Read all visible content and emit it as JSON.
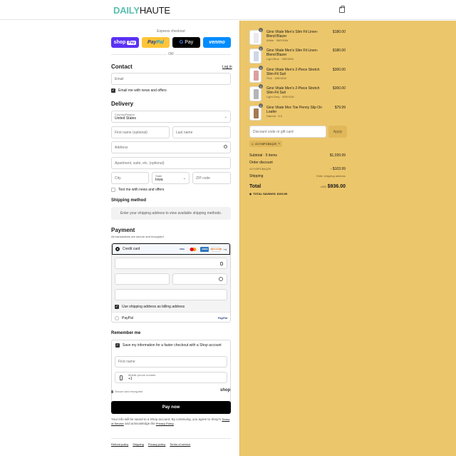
{
  "brand": {
    "part1": "DAILY",
    "part2": "HAUTE"
  },
  "express": {
    "label": "Express checkout",
    "shop": "shop",
    "shop_pay": "Pay",
    "paypal_a": "Pay",
    "paypal_b": "Pal",
    "gpay": "Pay",
    "gpay_g": "G",
    "venmo": "venmo",
    "or": "OR"
  },
  "contact": {
    "title": "Contact",
    "login": "Log in",
    "email_placeholder": "Email",
    "news_label": "Email me with news and offers"
  },
  "delivery": {
    "title": "Delivery",
    "country_label": "Country/Region",
    "country_value": "United States",
    "first_name": "First name (optional)",
    "last_name": "Last name",
    "address": "Address",
    "apartment": "Apartment, suite, etc. (optional)",
    "city": "City",
    "state_label": "State",
    "state_value": "Iowa",
    "zip": "ZIP code",
    "text_news": "Text me with news and offers"
  },
  "shipping_method": {
    "title": "Shipping method",
    "message": "Enter your shipping address to view available shipping methods."
  },
  "payment": {
    "title": "Payment",
    "subtitle": "All transactions are secure and encrypted.",
    "credit_card": "Credit card",
    "cards": [
      "VISA",
      "MC",
      "AMEX",
      "DISCOVER"
    ],
    "more": "+4",
    "billing_same": "Use shipping address as billing address",
    "paypal": "PayPal",
    "paypal_logo": "PayPal"
  },
  "remember": {
    "title": "Remember me",
    "save_label": "Save my information for a faster checkout with a Shop account",
    "first_name": "First name",
    "phone_label": "Mobile phone number",
    "phone_value": "+1",
    "secure": "Secure and encrypted",
    "shop": "shop"
  },
  "pay_now": "Pay now",
  "legal": {
    "text": "Your info will be saved to a Shop account. By continuing, you agree to Shop’s",
    "tos": "Terms of Service",
    "and": "and acknowledge the",
    "privacy": "Privacy Policy"
  },
  "footer": [
    "Refund policy",
    "Shipping",
    "Privacy policy",
    "Terms of service"
  ],
  "cart": {
    "items": [
      {
        "qty": "1",
        "title": "Gino Vitale Men's Slim Fit Linen-Blend Blazer",
        "variant": "White · 36R/30W",
        "price": "$180.00",
        "color": "#e9e9ee"
      },
      {
        "qty": "1",
        "title": "Gino Vitale Men's Slim Fit Linen-Blend Blazer",
        "variant": "Light Blue · 36R/30W",
        "price": "$180.00",
        "color": "#cdd7e6"
      },
      {
        "qty": "1",
        "title": "Gino Vitale Men's 2-Piece Stretch Slim-Fit Suit",
        "variant": "Pink · 48R/42W",
        "price": "$300.00",
        "color": "#d9a0a0"
      },
      {
        "qty": "1",
        "title": "Gino Vitale Men's 2-Piece Stretch Slim-Fit Suit",
        "variant": "Light Grey · 40R/42W",
        "price": "$300.00",
        "color": "#b5b5b8"
      },
      {
        "qty": "1",
        "title": "Gino Vitale Moc Toe Penny Slip On Loafer",
        "variant": "Natural · 6.5",
        "price": "$79.99",
        "color": "#a57a55"
      }
    ],
    "discount_placeholder": "Discount code or gift card",
    "apply": "Apply",
    "code": "41YX5PCB4Q29",
    "subtotal_label": "Subtotal · 5 items",
    "subtotal": "$1,039.99",
    "order_discount": "Order discount",
    "discount_code": "41YX5PCB4Q29",
    "discount_value": "- $103.99",
    "shipping_label": "Shipping",
    "shipping_value": "Enter shipping address",
    "total_label": "Total",
    "currency": "USD",
    "total": "$936.00",
    "savings_label": "TOTAL SAVINGS",
    "savings": "$103.99"
  }
}
